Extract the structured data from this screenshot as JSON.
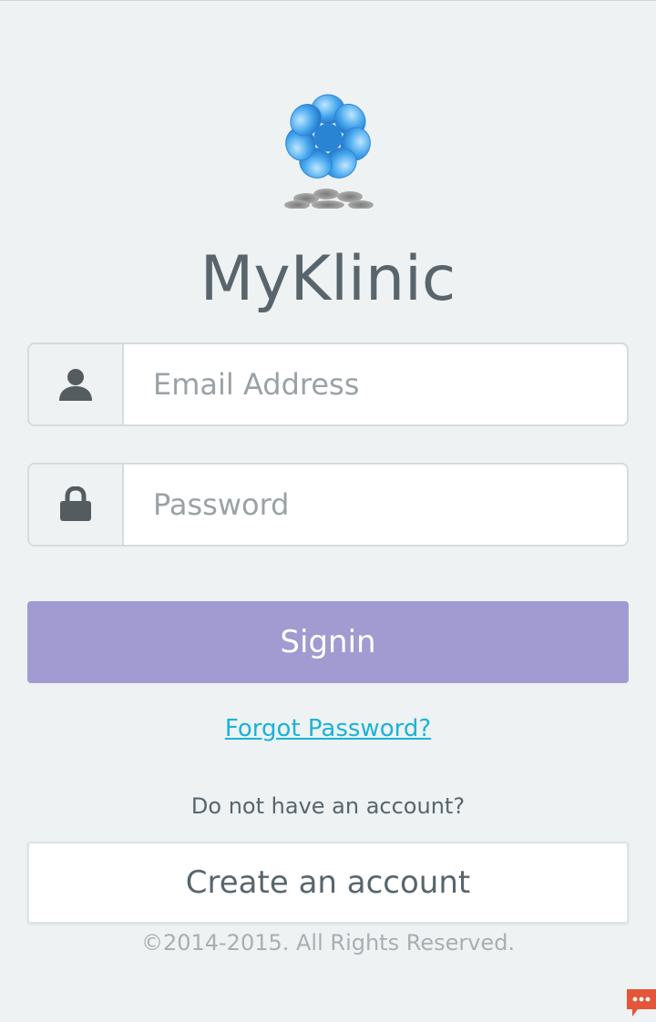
{
  "app": {
    "title": "MyKlinic"
  },
  "login_form": {
    "email_placeholder": "Email Address",
    "password_placeholder": "Password",
    "signin_label": "Signin",
    "forgot_password_label": "Forgot Password?"
  },
  "signup": {
    "prompt": "Do not have an account?",
    "create_account_label": "Create an account"
  },
  "footer": {
    "copyright": "©2014-2015. All Rights Reserved."
  },
  "icons": {
    "logo": "flower-logo-icon",
    "email": "user-icon",
    "password": "lock-icon",
    "chat": "chat-bubble-icon"
  },
  "colors": {
    "background": "#eef2f3",
    "title": "#58656d",
    "signin_button": "#a19bd1",
    "link": "#1ab3d8",
    "logo_blue": "#3a9fe6",
    "chat_widget": "#e4553a"
  }
}
